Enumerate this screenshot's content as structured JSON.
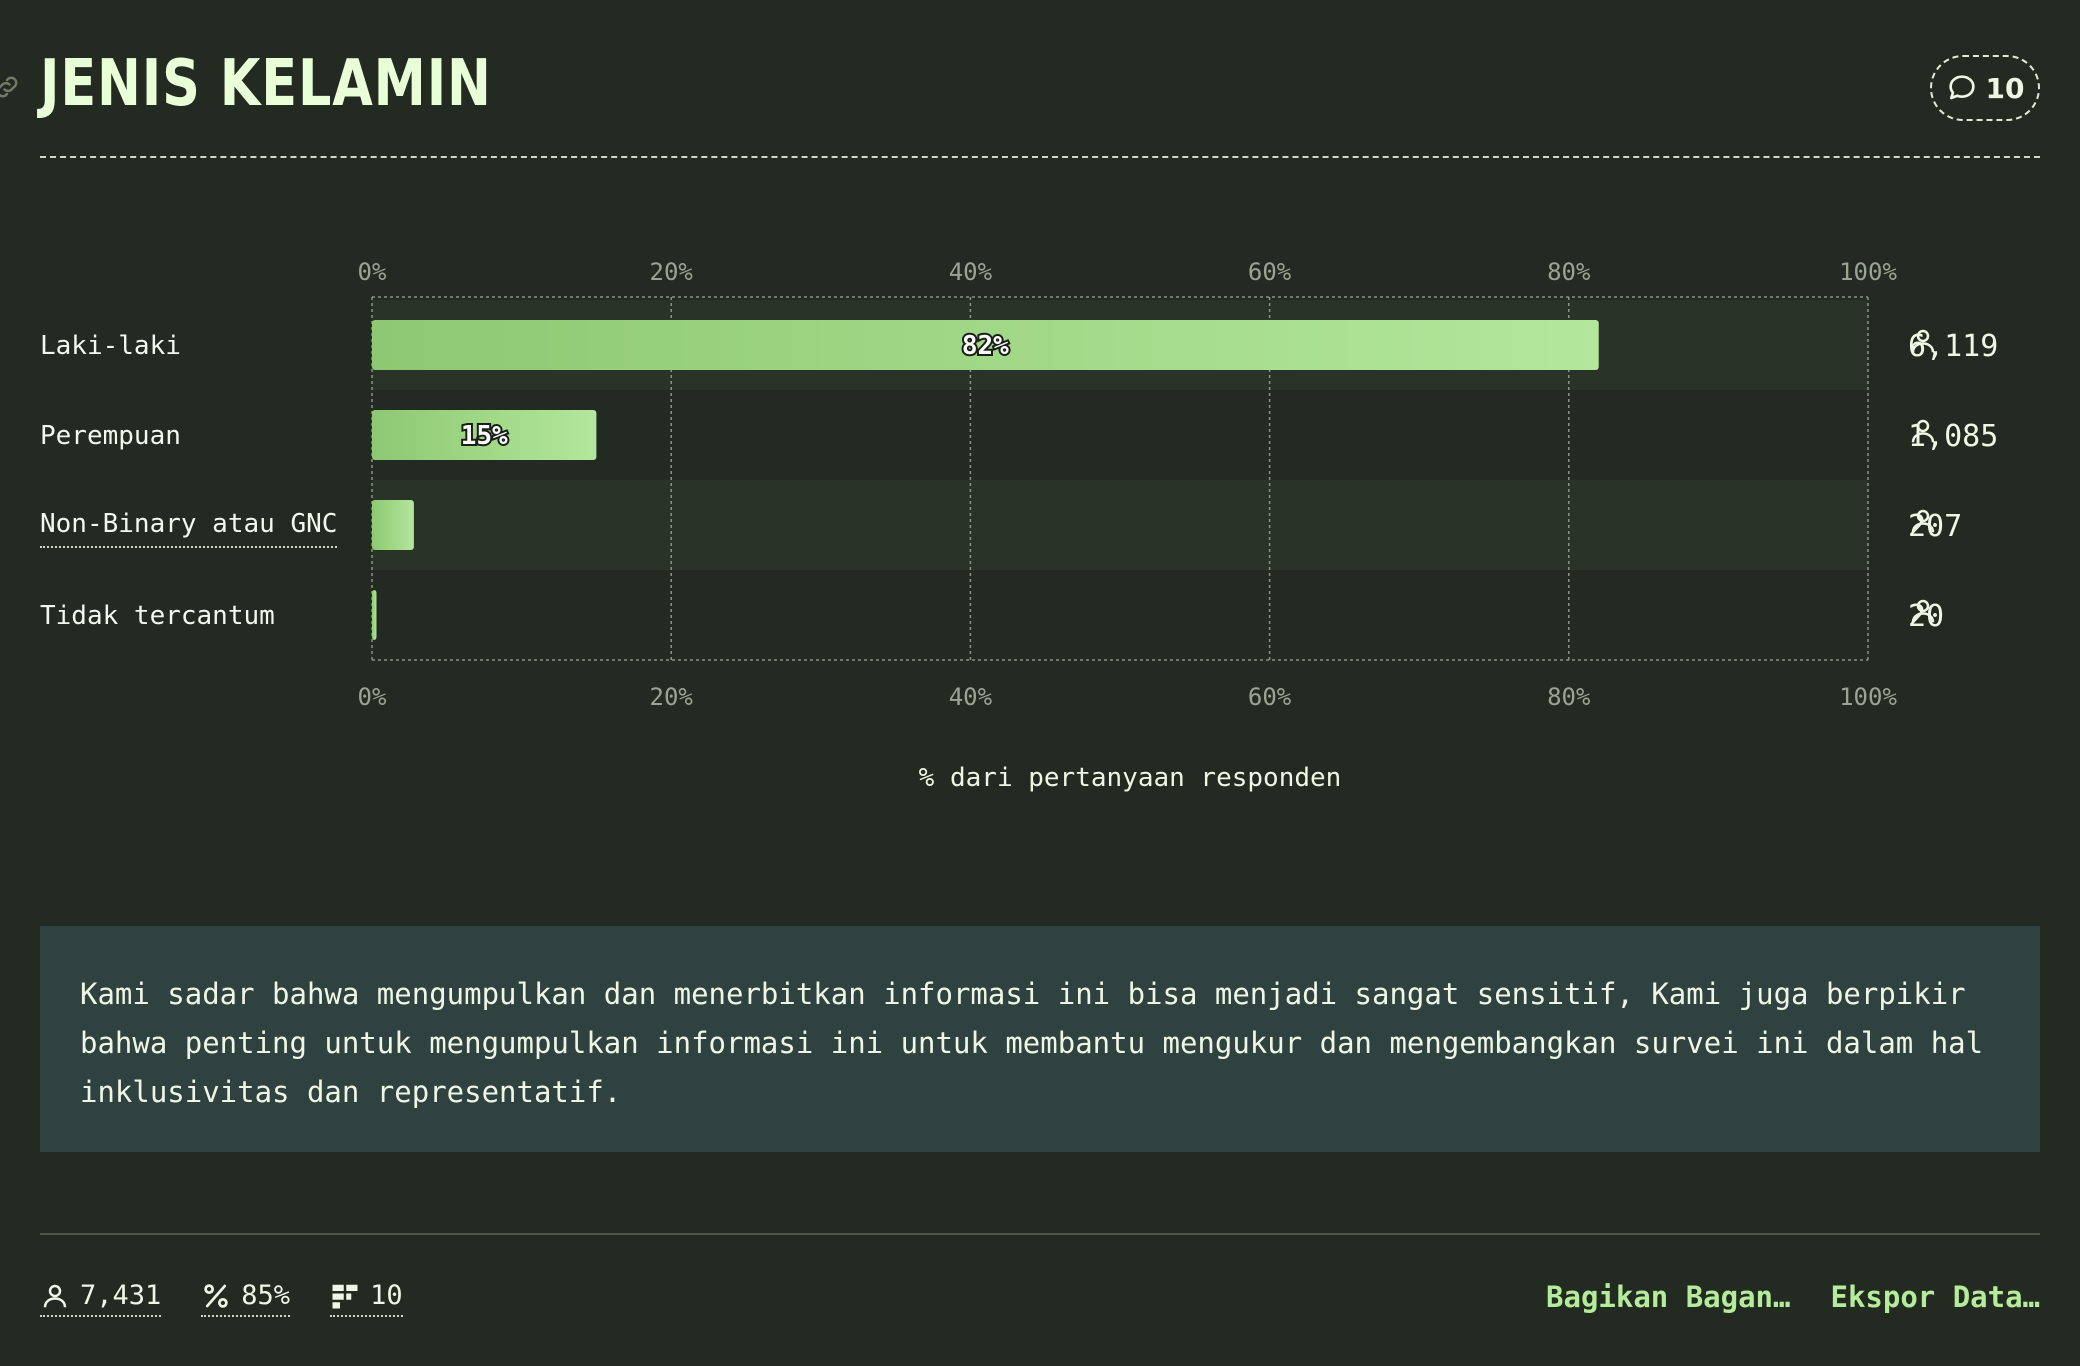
{
  "header": {
    "title": "JENIS KELAMIN",
    "comments_count": "10"
  },
  "chart_data": {
    "type": "bar",
    "orientation": "horizontal",
    "categories": [
      "Laki-laki",
      "Perempuan",
      "Non-Binary atau GNC",
      "Tidak tercantum"
    ],
    "values": [
      82,
      15,
      2.8,
      0.3
    ],
    "value_labels": [
      "82%",
      "15%",
      "",
      ""
    ],
    "respondent_counts": [
      "6,119",
      "1,085",
      "207",
      "20"
    ],
    "xlabel": "% dari pertanyaan responden",
    "xlim": [
      0,
      100
    ],
    "xticks": [
      "0%",
      "20%",
      "40%",
      "60%",
      "80%",
      "100%"
    ],
    "grid": true,
    "colors": {
      "bar_start": "#8ec872",
      "bar_end": "#b3e79c",
      "row_alt": "#2a3328",
      "grid": "#8a9585"
    }
  },
  "note": {
    "text": "Kami sadar bahwa mengumpulkan dan menerbitkan informasi ini bisa menjadi sangat sensitif, Kami juga berpikir bahwa penting untuk mengumpulkan informasi ini untuk membantu mengukur dan mengembangkan survei ini dalam hal inklusivitas dan representatif."
  },
  "footer": {
    "respondents": "7,431",
    "percent": "85%",
    "questions": "10",
    "share_label": "Bagikan Bagan…",
    "export_label": "Ekspor Data…"
  }
}
